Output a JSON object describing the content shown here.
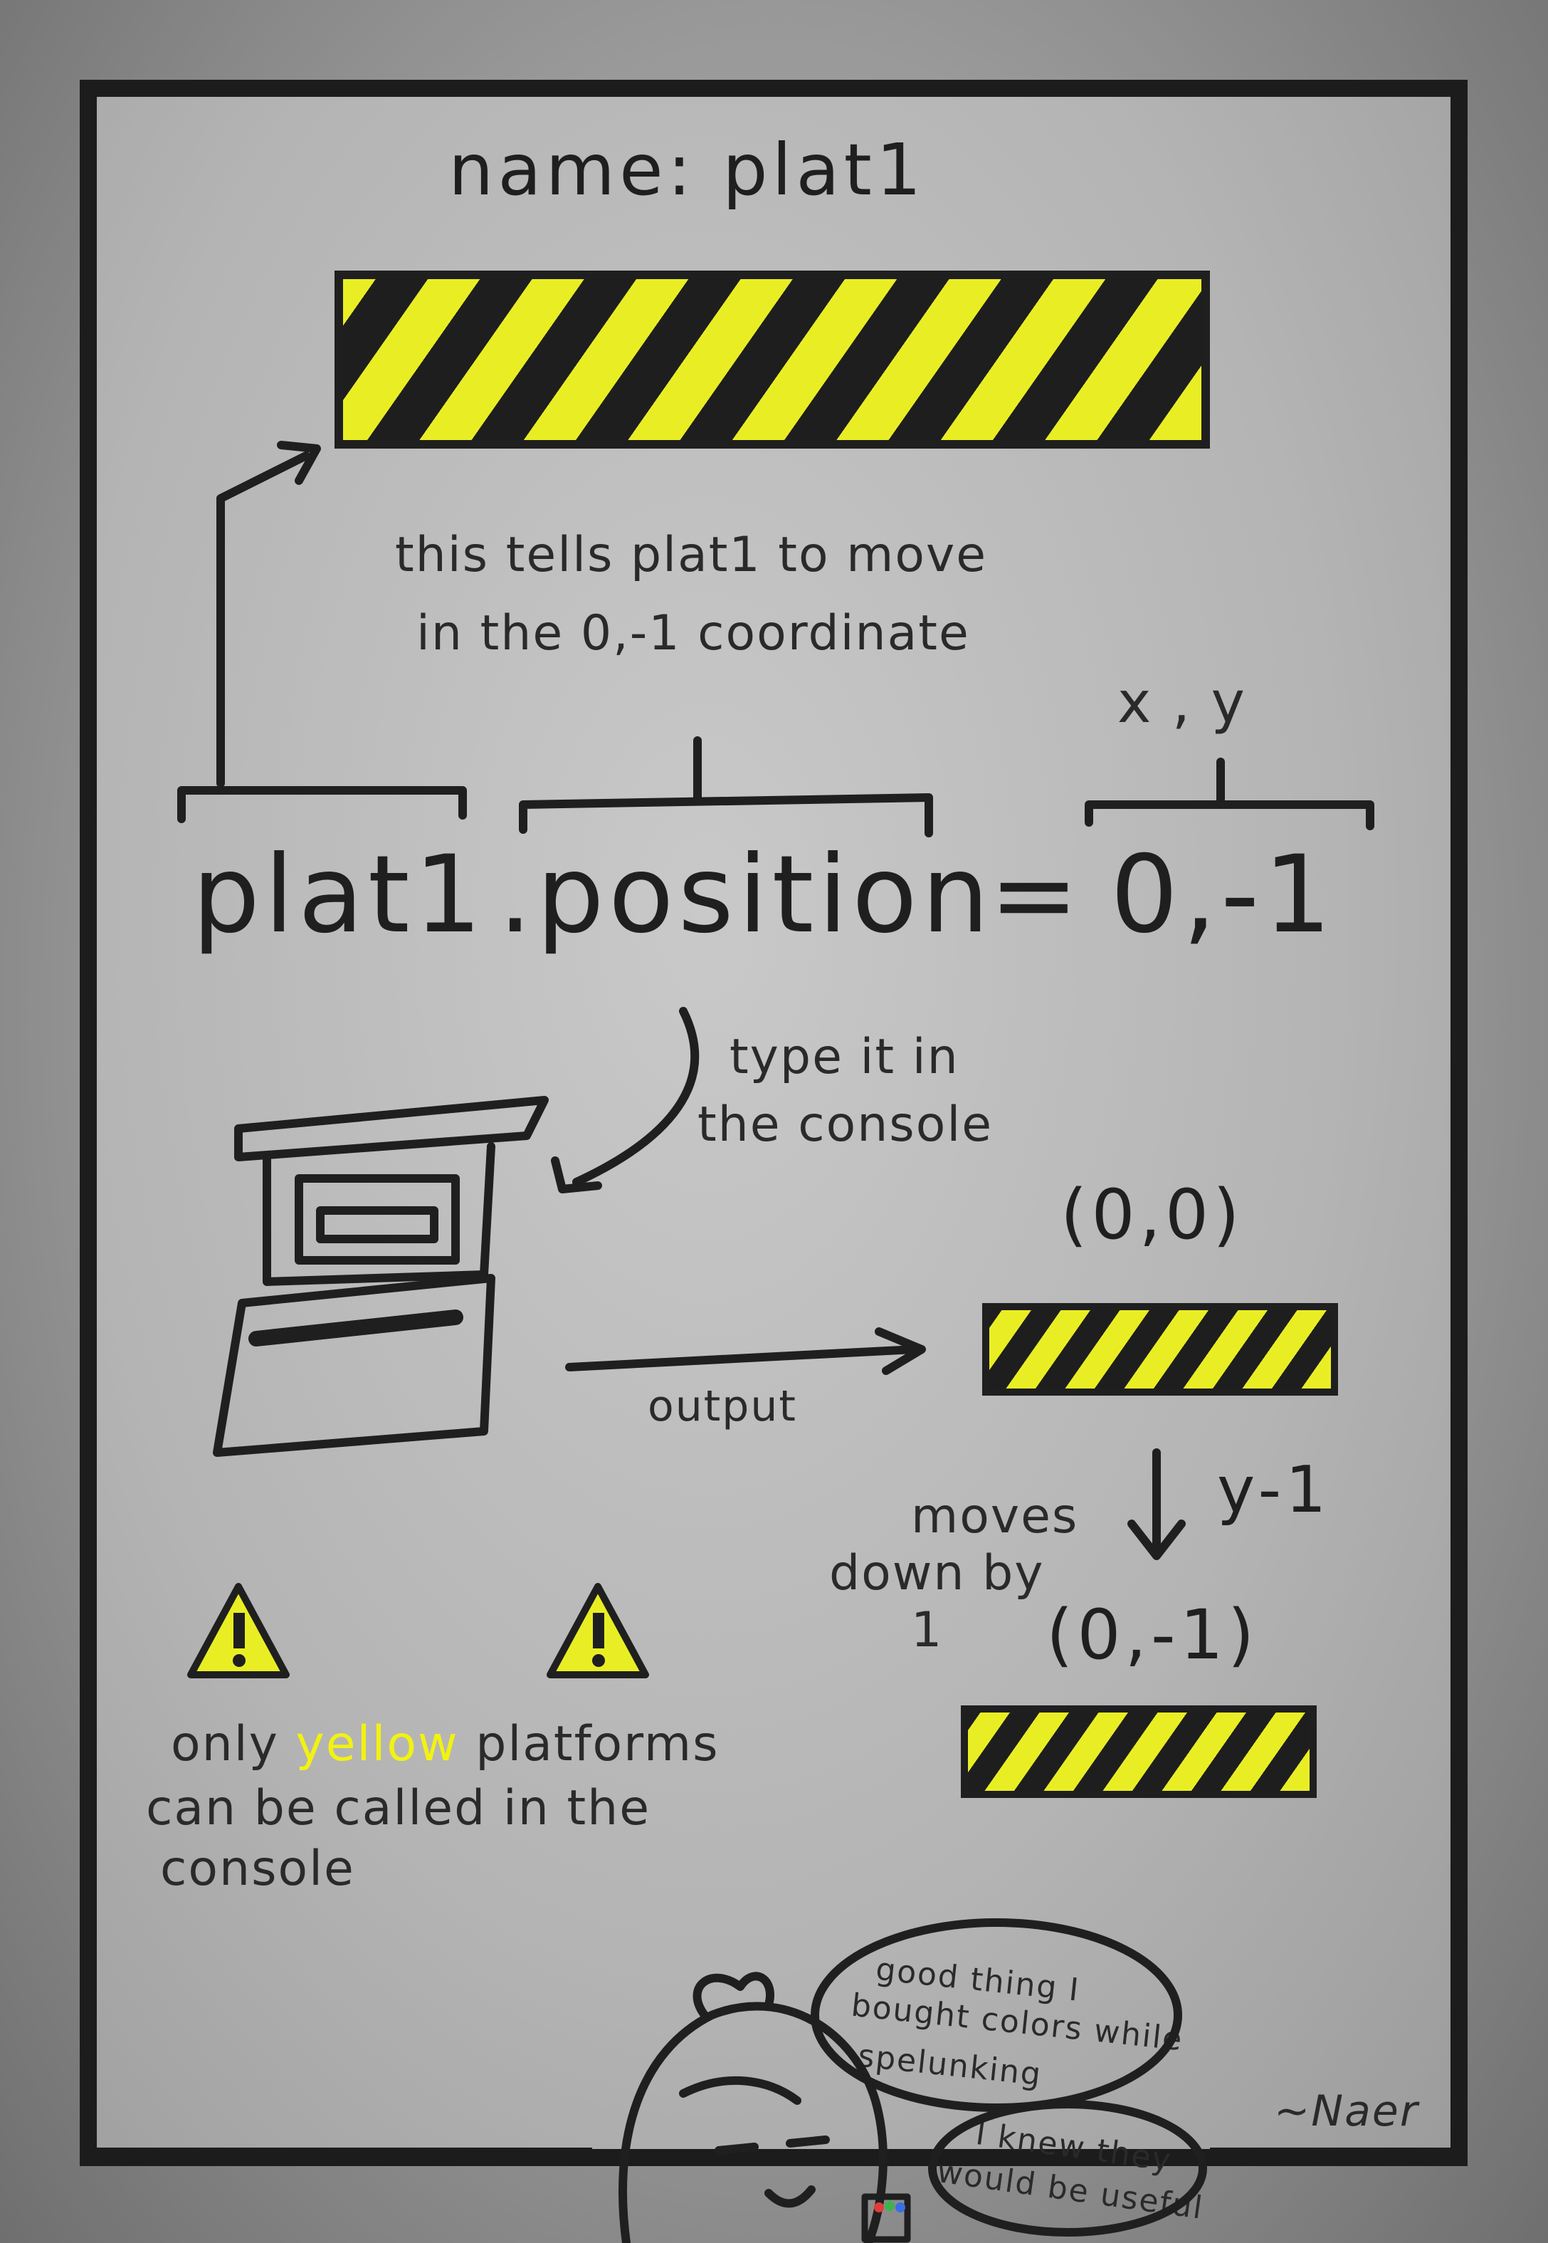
{
  "title": "name: plat1",
  "explain": {
    "line1": "this tells plat1 to move",
    "line2": "in the 0,-1 coordinate"
  },
  "code": {
    "object": "plat1",
    "property": ".position",
    "equals": "=",
    "value": "0,-1",
    "xy_label": "x , y"
  },
  "console_note": {
    "line1": "type it in",
    "line2": "the console"
  },
  "output_label": "output",
  "coord_before": "(0,0)",
  "coord_after": "(0,-1)",
  "move_label": "y-1",
  "moves": {
    "line1": "moves",
    "line2": "down by",
    "line3": "1"
  },
  "warning": {
    "prefix": "only",
    "highlight": "yellow",
    "rest1": "platforms",
    "line2": "can be called in the",
    "line3": "console"
  },
  "bubble1": {
    "line1": "good thing I",
    "line2": "bought colors while",
    "line3": "spelunking"
  },
  "bubble2": {
    "line1": "I knew they",
    "line2": "would be useful"
  },
  "signature": "~Naer",
  "colors": {
    "hazard_yellow": "#e9ee24",
    "hazard_black": "#1e1e1e",
    "ink": "#1f1f1f",
    "panel_border": "#1c1c1c"
  }
}
